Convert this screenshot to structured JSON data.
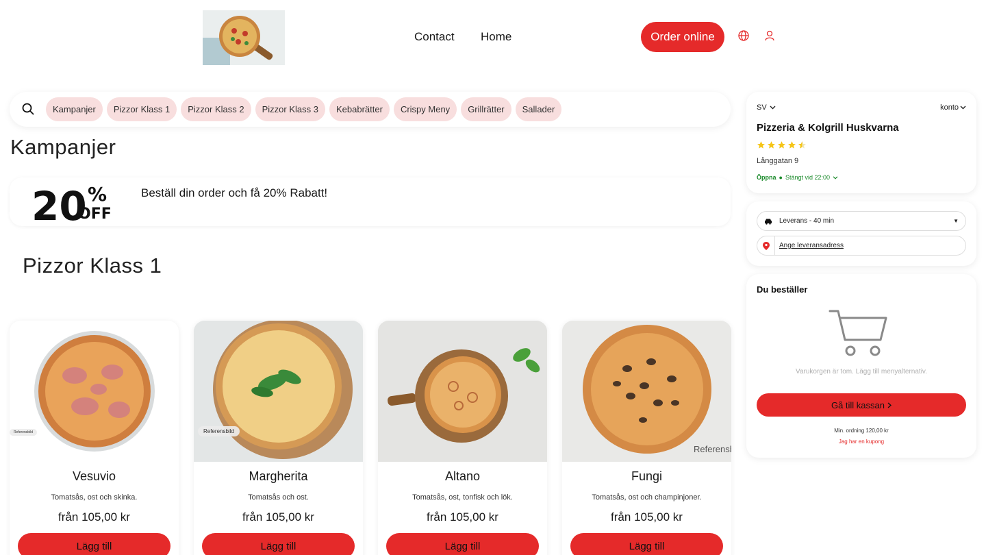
{
  "header": {
    "nav": [
      "Contact",
      "Home"
    ],
    "order_online": "Order online"
  },
  "categories": [
    "Kampanjer",
    "Pizzor Klass 1",
    "Pizzor Klass 2",
    "Pizzor Klass 3",
    "Kebabrätter",
    "Crispy Meny",
    "Grillrätter",
    "Sallader"
  ],
  "campaign": {
    "title": "Kampanjer",
    "graphic_big": "20",
    "graphic_pct": "%",
    "graphic_off": "OFF",
    "text": "Beställ din order och få 20% Rabatt!"
  },
  "menu_section": {
    "title": "Pizzor Klass 1",
    "reference_label": "Referensbild",
    "add_label": "Lägg till",
    "items": [
      {
        "name": "Vesuvio",
        "desc": "Tomatsås, ost och skinka.",
        "price": "från 105,00 kr"
      },
      {
        "name": "Margherita",
        "desc": "Tomatsås och ost.",
        "price": "från 105,00 kr"
      },
      {
        "name": "Altano",
        "desc": "Tomatsås, ost, tonfisk och lök.",
        "price": "från 105,00 kr"
      },
      {
        "name": "Fungi",
        "desc": "Tomatsås, ost och champinjoner.",
        "price": "från 105,00 kr"
      }
    ]
  },
  "restaurant": {
    "language": "SV",
    "account": "konto",
    "name": "Pizzeria & Kolgrill Huskvarna",
    "rating": 4.5,
    "address": "Långgatan 9",
    "open": "Öppna",
    "closes": "Stängt vid 22:00"
  },
  "delivery": {
    "mode": "Leverans - 40 min",
    "address_placeholder": "Ange leveransadress"
  },
  "cart": {
    "title": "Du beställer",
    "empty_text": "Varukorgen är tom. Lägg till menyalternativ.",
    "checkout": "Gå till kassan",
    "min_order": "Min. ordning 120,00 kr",
    "coupon": "Jag har en kupong"
  },
  "colors": {
    "accent": "#e52a2a",
    "pill": "#f8dede",
    "open_green": "#1a8a2a",
    "star": "#f5c518"
  }
}
